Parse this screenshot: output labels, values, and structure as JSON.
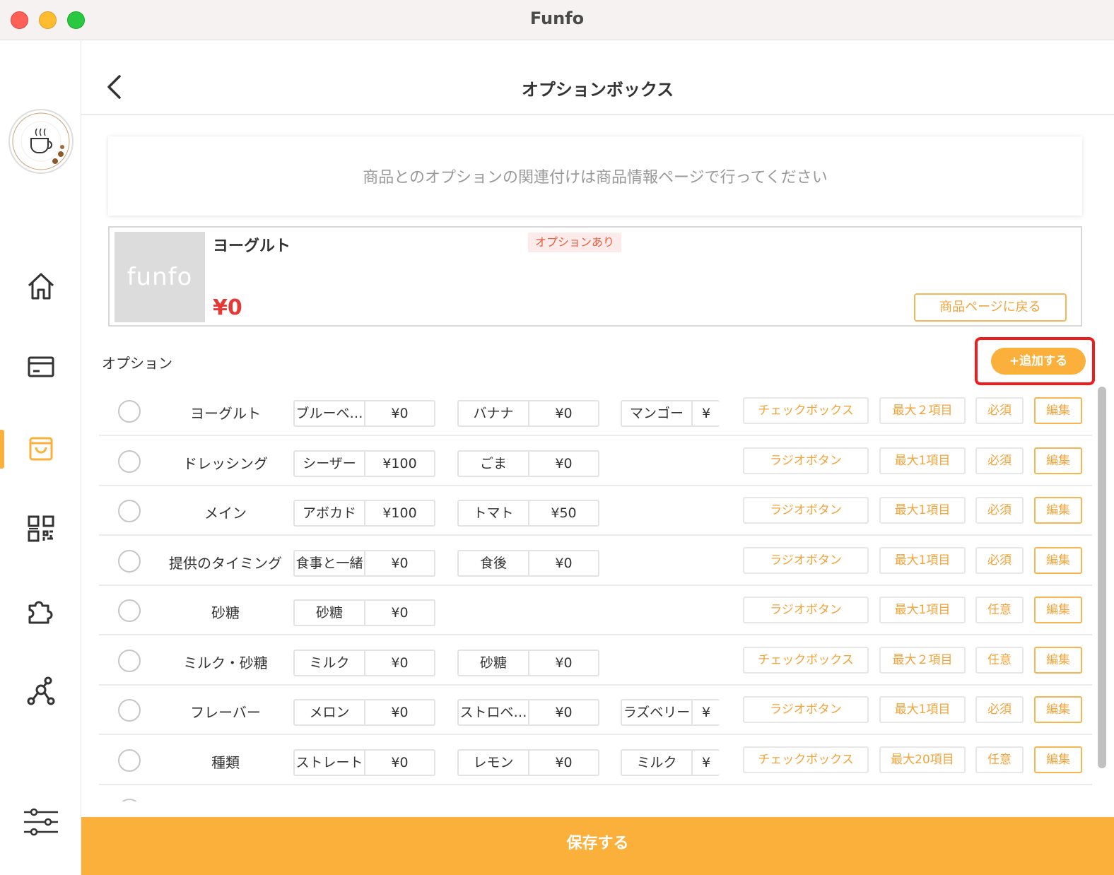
{
  "window": {
    "title": "Funfo"
  },
  "header": {
    "title": "オプションボックス"
  },
  "notice": "商品とのオプションの関連付けは商品情報ページで行ってください",
  "product": {
    "thumb_text": "funfo",
    "name": "ヨーグルト",
    "badge": "オプションあり",
    "price": "¥0",
    "back_button": "商品ページに戻る"
  },
  "options": {
    "label": "オプション",
    "add_button": "+追加する"
  },
  "rows": [
    {
      "name": "ヨーグルト",
      "items": [
        {
          "n": "ブルーベ…",
          "p": "¥0"
        },
        {
          "n": "バナナ",
          "p": "¥0"
        },
        {
          "n": "マンゴー",
          "p": "¥"
        }
      ],
      "type": "チェックボックス",
      "max": "最大２項目",
      "req": "必須",
      "edit": "編集"
    },
    {
      "name": "ドレッシング",
      "items": [
        {
          "n": "シーザー",
          "p": "¥100"
        },
        {
          "n": "ごま",
          "p": "¥0"
        }
      ],
      "type": "ラジオボタン",
      "max": "最大1項目",
      "req": "必須",
      "edit": "編集"
    },
    {
      "name": "メイン",
      "items": [
        {
          "n": "アボカド",
          "p": "¥100"
        },
        {
          "n": "トマト",
          "p": "¥50"
        }
      ],
      "type": "ラジオボタン",
      "max": "最大1項目",
      "req": "必須",
      "edit": "編集"
    },
    {
      "name": "提供のタイミング",
      "items": [
        {
          "n": "食事と一緒",
          "p": "¥0"
        },
        {
          "n": "食後",
          "p": "¥0"
        }
      ],
      "type": "ラジオボタン",
      "max": "最大1項目",
      "req": "必須",
      "edit": "編集"
    },
    {
      "name": "砂糖",
      "items": [
        {
          "n": "砂糖",
          "p": "¥0"
        }
      ],
      "type": "ラジオボタン",
      "max": "最大1項目",
      "req": "任意",
      "edit": "編集"
    },
    {
      "name": "ミルク・砂糖",
      "items": [
        {
          "n": "ミルク",
          "p": "¥0"
        },
        {
          "n": "砂糖",
          "p": "¥0"
        }
      ],
      "type": "チェックボックス",
      "max": "最大２項目",
      "req": "任意",
      "edit": "編集"
    },
    {
      "name": "フレーバー",
      "items": [
        {
          "n": "メロン",
          "p": "¥0"
        },
        {
          "n": "ストロベ…",
          "p": "¥0"
        },
        {
          "n": "ラズベリー",
          "p": "¥"
        }
      ],
      "type": "ラジオボタン",
      "max": "最大1項目",
      "req": "必須",
      "edit": "編集"
    },
    {
      "name": "種類",
      "items": [
        {
          "n": "ストレート",
          "p": "¥0"
        },
        {
          "n": "レモン",
          "p": "¥0"
        },
        {
          "n": "ミルク",
          "p": "¥"
        }
      ],
      "type": "チェックボックス",
      "max": "最大20項目",
      "req": "任意",
      "edit": "編集"
    }
  ],
  "save_button": "保存する",
  "colors": {
    "accent": "#fbb03b",
    "price": "#e53935",
    "highlight": "#ee1c1c"
  },
  "icons": [
    "back-arrow-icon",
    "home-icon",
    "card-icon",
    "shopping-bag-icon",
    "qr-code-icon",
    "puzzle-icon",
    "share-network-icon",
    "sliders-icon"
  ]
}
